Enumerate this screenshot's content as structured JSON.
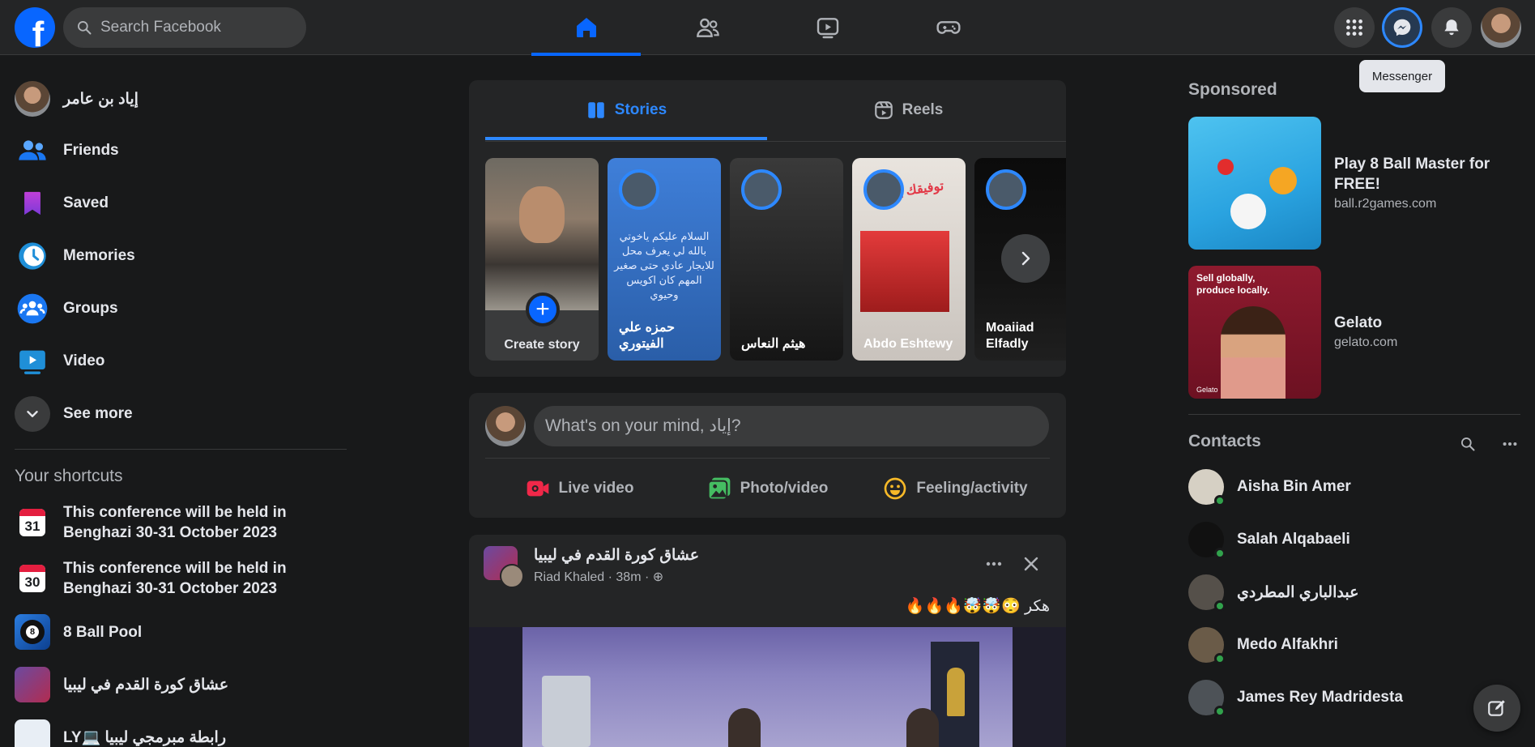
{
  "header": {
    "logo_letter": "f",
    "search_placeholder": "Search Facebook",
    "tooltip": "Messenger",
    "nav": [
      "home-icon",
      "friends-icon",
      "watch-icon",
      "gaming-icon"
    ]
  },
  "sidebar": {
    "profile_name": "إياد بن عامر",
    "items": [
      {
        "label": "Friends",
        "icon": "friends-icon"
      },
      {
        "label": "Saved",
        "icon": "bookmark-icon"
      },
      {
        "label": "Memories",
        "icon": "clock-icon"
      },
      {
        "label": "Groups",
        "icon": "groups-icon"
      },
      {
        "label": "Video",
        "icon": "video-icon"
      },
      {
        "label": "See more",
        "icon": "chevron-down-icon"
      }
    ],
    "shortcuts_title": "Your shortcuts",
    "shortcuts": [
      {
        "label": "This conference will be held in Benghazi 30-31 October 2023",
        "day": "31"
      },
      {
        "label": "This conference will be held in Benghazi 30-31 October 2023",
        "day": "30"
      },
      {
        "label": "8 Ball Pool",
        "ball_number": "8"
      },
      {
        "label": "عشاق كورة القدم في ليبيا"
      },
      {
        "label": "رابطة مبرمجي ليبيا 💻LY"
      }
    ]
  },
  "stories": {
    "tabs": [
      "Stories",
      "Reels"
    ],
    "create_label": "Create story",
    "create_plus": "+",
    "items": [
      {
        "name": "حمزه علي الفيتوري",
        "text": "السلام عليكم ياخوتي بالله لي يعرف محل للايجار عادي حتى صغير المهم كان اكويس وحيوي"
      },
      {
        "name": "هيثم النعاس"
      },
      {
        "name": "Abdo Eshtewy",
        "overlay": "توفيقك يارب"
      },
      {
        "name": "Moaiiad Elfadly"
      }
    ]
  },
  "composer": {
    "placeholder": "What's on your mind, إياد?",
    "actions": [
      "Live video",
      "Photo/video",
      "Feeling/activity"
    ]
  },
  "post": {
    "group_name": "عشاق كورة القدم في ليبيا",
    "meta": "Riad Khaled · 38m · ⊕",
    "caption": "هكر 😳🤯🤯🔥🔥🔥"
  },
  "right": {
    "sponsored_title": "Sponsored",
    "ads": [
      {
        "title": "Play 8 Ball Master for FREE!",
        "url": "ball.r2games.com"
      },
      {
        "title": "Gelato",
        "url": "gelato.com",
        "thumb_text": "Sell globally, produce locally.",
        "thumb_brand": "Gelato"
      }
    ],
    "contacts_title": "Contacts",
    "contacts": [
      {
        "name": "Aisha Bin Amer",
        "color": "#d6d0c4"
      },
      {
        "name": "Salah Alqabaeli",
        "color": "#111111"
      },
      {
        "name": "عبدالباري المطردي",
        "color": "#55504a"
      },
      {
        "name": "Medo Alfakhri",
        "color": "#6a5b48"
      },
      {
        "name": "James Rey Madridesta",
        "color": "#4d5257"
      }
    ]
  },
  "colors": {
    "accent": "#0866ff",
    "link_blue": "#2d88ff",
    "background": "#18191a",
    "surface": "#242526",
    "online": "#31a24c"
  }
}
